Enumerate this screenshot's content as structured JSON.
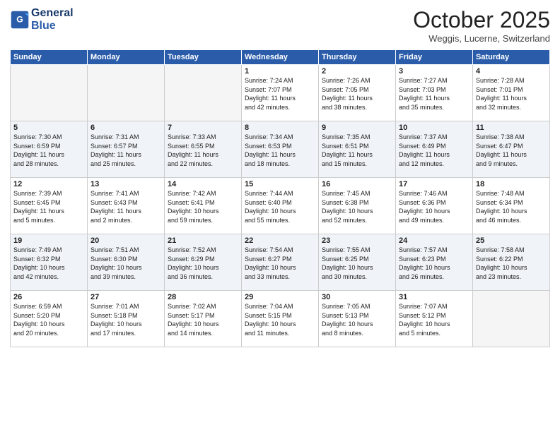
{
  "header": {
    "logo_line1": "General",
    "logo_line2": "Blue",
    "month": "October 2025",
    "location": "Weggis, Lucerne, Switzerland"
  },
  "days_of_week": [
    "Sunday",
    "Monday",
    "Tuesday",
    "Wednesday",
    "Thursday",
    "Friday",
    "Saturday"
  ],
  "weeks": [
    [
      {
        "num": "",
        "info": "",
        "empty": true
      },
      {
        "num": "",
        "info": "",
        "empty": true
      },
      {
        "num": "",
        "info": "",
        "empty": true
      },
      {
        "num": "1",
        "info": "Sunrise: 7:24 AM\nSunset: 7:07 PM\nDaylight: 11 hours\nand 42 minutes.",
        "empty": false
      },
      {
        "num": "2",
        "info": "Sunrise: 7:26 AM\nSunset: 7:05 PM\nDaylight: 11 hours\nand 38 minutes.",
        "empty": false
      },
      {
        "num": "3",
        "info": "Sunrise: 7:27 AM\nSunset: 7:03 PM\nDaylight: 11 hours\nand 35 minutes.",
        "empty": false
      },
      {
        "num": "4",
        "info": "Sunrise: 7:28 AM\nSunset: 7:01 PM\nDaylight: 11 hours\nand 32 minutes.",
        "empty": false
      }
    ],
    [
      {
        "num": "5",
        "info": "Sunrise: 7:30 AM\nSunset: 6:59 PM\nDaylight: 11 hours\nand 28 minutes.",
        "empty": false
      },
      {
        "num": "6",
        "info": "Sunrise: 7:31 AM\nSunset: 6:57 PM\nDaylight: 11 hours\nand 25 minutes.",
        "empty": false
      },
      {
        "num": "7",
        "info": "Sunrise: 7:33 AM\nSunset: 6:55 PM\nDaylight: 11 hours\nand 22 minutes.",
        "empty": false
      },
      {
        "num": "8",
        "info": "Sunrise: 7:34 AM\nSunset: 6:53 PM\nDaylight: 11 hours\nand 18 minutes.",
        "empty": false
      },
      {
        "num": "9",
        "info": "Sunrise: 7:35 AM\nSunset: 6:51 PM\nDaylight: 11 hours\nand 15 minutes.",
        "empty": false
      },
      {
        "num": "10",
        "info": "Sunrise: 7:37 AM\nSunset: 6:49 PM\nDaylight: 11 hours\nand 12 minutes.",
        "empty": false
      },
      {
        "num": "11",
        "info": "Sunrise: 7:38 AM\nSunset: 6:47 PM\nDaylight: 11 hours\nand 9 minutes.",
        "empty": false
      }
    ],
    [
      {
        "num": "12",
        "info": "Sunrise: 7:39 AM\nSunset: 6:45 PM\nDaylight: 11 hours\nand 5 minutes.",
        "empty": false
      },
      {
        "num": "13",
        "info": "Sunrise: 7:41 AM\nSunset: 6:43 PM\nDaylight: 11 hours\nand 2 minutes.",
        "empty": false
      },
      {
        "num": "14",
        "info": "Sunrise: 7:42 AM\nSunset: 6:41 PM\nDaylight: 10 hours\nand 59 minutes.",
        "empty": false
      },
      {
        "num": "15",
        "info": "Sunrise: 7:44 AM\nSunset: 6:40 PM\nDaylight: 10 hours\nand 55 minutes.",
        "empty": false
      },
      {
        "num": "16",
        "info": "Sunrise: 7:45 AM\nSunset: 6:38 PM\nDaylight: 10 hours\nand 52 minutes.",
        "empty": false
      },
      {
        "num": "17",
        "info": "Sunrise: 7:46 AM\nSunset: 6:36 PM\nDaylight: 10 hours\nand 49 minutes.",
        "empty": false
      },
      {
        "num": "18",
        "info": "Sunrise: 7:48 AM\nSunset: 6:34 PM\nDaylight: 10 hours\nand 46 minutes.",
        "empty": false
      }
    ],
    [
      {
        "num": "19",
        "info": "Sunrise: 7:49 AM\nSunset: 6:32 PM\nDaylight: 10 hours\nand 42 minutes.",
        "empty": false
      },
      {
        "num": "20",
        "info": "Sunrise: 7:51 AM\nSunset: 6:30 PM\nDaylight: 10 hours\nand 39 minutes.",
        "empty": false
      },
      {
        "num": "21",
        "info": "Sunrise: 7:52 AM\nSunset: 6:29 PM\nDaylight: 10 hours\nand 36 minutes.",
        "empty": false
      },
      {
        "num": "22",
        "info": "Sunrise: 7:54 AM\nSunset: 6:27 PM\nDaylight: 10 hours\nand 33 minutes.",
        "empty": false
      },
      {
        "num": "23",
        "info": "Sunrise: 7:55 AM\nSunset: 6:25 PM\nDaylight: 10 hours\nand 30 minutes.",
        "empty": false
      },
      {
        "num": "24",
        "info": "Sunrise: 7:57 AM\nSunset: 6:23 PM\nDaylight: 10 hours\nand 26 minutes.",
        "empty": false
      },
      {
        "num": "25",
        "info": "Sunrise: 7:58 AM\nSunset: 6:22 PM\nDaylight: 10 hours\nand 23 minutes.",
        "empty": false
      }
    ],
    [
      {
        "num": "26",
        "info": "Sunrise: 6:59 AM\nSunset: 5:20 PM\nDaylight: 10 hours\nand 20 minutes.",
        "empty": false
      },
      {
        "num": "27",
        "info": "Sunrise: 7:01 AM\nSunset: 5:18 PM\nDaylight: 10 hours\nand 17 minutes.",
        "empty": false
      },
      {
        "num": "28",
        "info": "Sunrise: 7:02 AM\nSunset: 5:17 PM\nDaylight: 10 hours\nand 14 minutes.",
        "empty": false
      },
      {
        "num": "29",
        "info": "Sunrise: 7:04 AM\nSunset: 5:15 PM\nDaylight: 10 hours\nand 11 minutes.",
        "empty": false
      },
      {
        "num": "30",
        "info": "Sunrise: 7:05 AM\nSunset: 5:13 PM\nDaylight: 10 hours\nand 8 minutes.",
        "empty": false
      },
      {
        "num": "31",
        "info": "Sunrise: 7:07 AM\nSunset: 5:12 PM\nDaylight: 10 hours\nand 5 minutes.",
        "empty": false
      },
      {
        "num": "",
        "info": "",
        "empty": true
      }
    ]
  ]
}
